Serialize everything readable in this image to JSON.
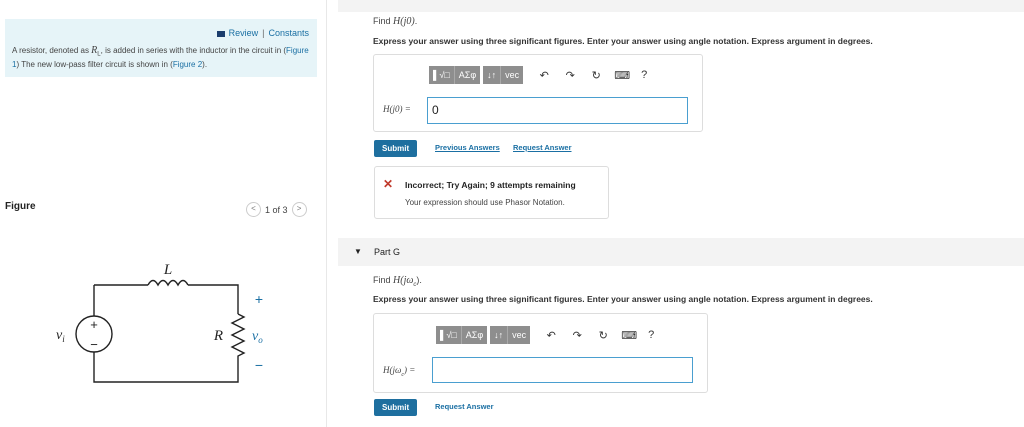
{
  "left": {
    "review_label": "Review",
    "separator": "|",
    "constants_label": "Constants",
    "description_pre": "A resistor, denoted as ",
    "description_var": "R",
    "description_sub": "L",
    "description_mid": ", is added in series with the inductor in the circuit in (",
    "figure1_link": "Figure 1",
    "description_mid2": ")  The new low-pass filter circuit is shown in (",
    "figure2_link": "Figure 2",
    "description_end": ").",
    "figure_label": "Figure",
    "pager_text": "1 of 3",
    "circuit": {
      "inductor": "L",
      "resistor": "R",
      "source": "v",
      "source_sub": "i",
      "output": "v",
      "output_sub": "o",
      "plus": "+",
      "minus": "−"
    }
  },
  "part_f": {
    "find_prefix": "Find ",
    "find_expr": "H(j0)",
    "find_suffix": ".",
    "instructions": "Express your answer using three significant figures. Enter your answer using angle notation. Express argument in degrees.",
    "toolbar": {
      "templates": "▌√□",
      "greek": "AΣφ",
      "arrows": "↓↑",
      "vec": "vec",
      "undo": "↶",
      "redo": "↷",
      "reset": "↻",
      "keyboard": "⌨",
      "help": "?"
    },
    "input_label": "H(j0) =",
    "input_value": "0",
    "submit_label": "Submit",
    "previous_answers": "Previous Answers",
    "request_answer": "Request Answer",
    "feedback_title": "Incorrect; Try Again; 9 attempts remaining",
    "feedback_text": "Your expression should use Phasor Notation."
  },
  "part_g": {
    "title": "Part G",
    "find_prefix": "Find ",
    "find_expr": "H(jω",
    "find_sub": "c",
    "find_suffix": ").",
    "instructions": "Express your answer using three significant figures. Enter your answer using angle notation. Express argument in degrees.",
    "toolbar": {
      "templates": "▌√□",
      "greek": "AΣφ",
      "arrows": "↓↑",
      "vec": "vec",
      "undo": "↶",
      "redo": "↷",
      "reset": "↻",
      "keyboard": "⌨",
      "help": "?"
    },
    "input_label_pre": "H(jω",
    "input_label_sub": "c",
    "input_label_post": ") =",
    "input_value": "",
    "submit_label": "Submit",
    "request_answer": "Request Answer"
  }
}
